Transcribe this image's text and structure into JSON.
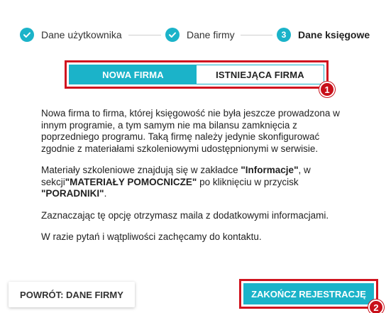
{
  "stepper": {
    "steps": [
      {
        "label": "Dane użytkownika",
        "state": "done"
      },
      {
        "label": "Dane firmy",
        "state": "done"
      },
      {
        "label": "Dane księgowe",
        "state": "current",
        "number": "3"
      }
    ]
  },
  "toggle": {
    "options": [
      {
        "label": "NOWA FIRMA",
        "active": true
      },
      {
        "label": "ISTNIEJĄCA FIRMA",
        "active": false
      }
    ]
  },
  "markers": {
    "first": "1",
    "second": "2"
  },
  "content": {
    "p1": "Nowa firma to firma, której księgowość nie była jeszcze prowadzona w innym programie, a tym samym nie ma bilansu zamknięcia z poprzedniego programu. Taką firmę należy jedynie skonfigurować zgodnie z materiałami szkoleniowymi udostępnionymi w serwisie.",
    "p2_a": "Materiały szkoleniowe znajdują się w zakładce ",
    "p2_b": "\"Informacje\"",
    "p2_c": ", w sekcji",
    "p2_d": "\"MATERIAŁY POMOCNICZE\"",
    "p2_e": " po kliknięciu w przycisk ",
    "p2_f": "\"PORADNIKI\"",
    "p2_g": ".",
    "p3": "Zaznaczając tę opcję otrzymasz maila z dodatkowymi informacjami.",
    "p4": "W razie pytań i wątpliwości zachęcamy do kontaktu."
  },
  "buttons": {
    "back": "POWRÓT: DANE FIRMY",
    "finish": "ZAKOŃCZ REJESTRACJĘ"
  },
  "colors": {
    "accent": "#1bb3c9",
    "highlight": "#d0141f"
  }
}
